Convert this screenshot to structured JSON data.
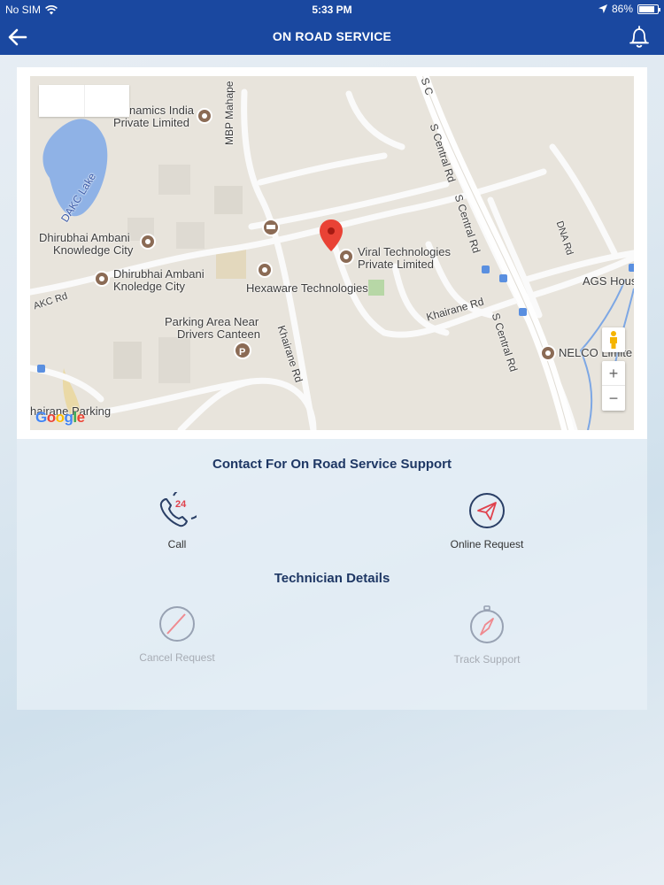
{
  "status_bar": {
    "carrier": "No SIM",
    "time": "5:33 PM",
    "battery_percent": "86%",
    "battery_level": 0.86
  },
  "header": {
    "title": "ON ROAD SERVICE"
  },
  "map": {
    "labels": [
      "namics India",
      "Private Limited",
      "MBP Mahape",
      "DAKC Lake",
      "Dhirubhai Ambani",
      "Knowledge City",
      "Dhirubhai Ambani",
      "Knoledge City",
      "AKC Rd",
      "Viral Technologies",
      "Private Limited",
      "Hexaware Technologies",
      "Parking Area Near",
      "Drivers Canteen",
      "Khairane Rd",
      "Khairane Rd",
      "S Central Rd",
      "S Central Rd",
      "S Central Rd",
      "DNA Rd",
      "AGS Hous",
      "NELCO Limite",
      "hairane Parking",
      "S C"
    ],
    "zoom_in": "+",
    "zoom_out": "−",
    "logo": "Google"
  },
  "contact": {
    "title": "Contact For On Road Service Support",
    "call_label": "Call",
    "call_badge": "24",
    "online_label": "Online Request"
  },
  "technician": {
    "title": "Technician Details",
    "cancel_label": "Cancel Request",
    "track_label": "Track Support"
  },
  "colors": {
    "header": "#1a48a0",
    "accent_red": "#e0424d",
    "icon_navy": "#2a3f66"
  }
}
